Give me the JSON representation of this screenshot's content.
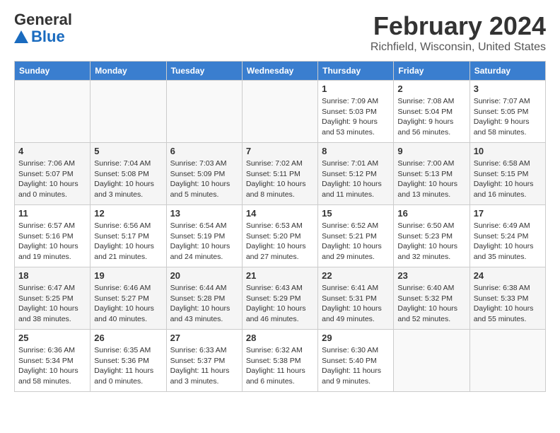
{
  "header": {
    "logo_general": "General",
    "logo_blue": "Blue",
    "title": "February 2024",
    "subtitle": "Richfield, Wisconsin, United States"
  },
  "columns": [
    "Sunday",
    "Monday",
    "Tuesday",
    "Wednesday",
    "Thursday",
    "Friday",
    "Saturday"
  ],
  "weeks": [
    [
      {
        "day": "",
        "info": ""
      },
      {
        "day": "",
        "info": ""
      },
      {
        "day": "",
        "info": ""
      },
      {
        "day": "",
        "info": ""
      },
      {
        "day": "1",
        "info": "Sunrise: 7:09 AM\nSunset: 5:03 PM\nDaylight: 9 hours\nand 53 minutes."
      },
      {
        "day": "2",
        "info": "Sunrise: 7:08 AM\nSunset: 5:04 PM\nDaylight: 9 hours\nand 56 minutes."
      },
      {
        "day": "3",
        "info": "Sunrise: 7:07 AM\nSunset: 5:05 PM\nDaylight: 9 hours\nand 58 minutes."
      }
    ],
    [
      {
        "day": "4",
        "info": "Sunrise: 7:06 AM\nSunset: 5:07 PM\nDaylight: 10 hours\nand 0 minutes."
      },
      {
        "day": "5",
        "info": "Sunrise: 7:04 AM\nSunset: 5:08 PM\nDaylight: 10 hours\nand 3 minutes."
      },
      {
        "day": "6",
        "info": "Sunrise: 7:03 AM\nSunset: 5:09 PM\nDaylight: 10 hours\nand 5 minutes."
      },
      {
        "day": "7",
        "info": "Sunrise: 7:02 AM\nSunset: 5:11 PM\nDaylight: 10 hours\nand 8 minutes."
      },
      {
        "day": "8",
        "info": "Sunrise: 7:01 AM\nSunset: 5:12 PM\nDaylight: 10 hours\nand 11 minutes."
      },
      {
        "day": "9",
        "info": "Sunrise: 7:00 AM\nSunset: 5:13 PM\nDaylight: 10 hours\nand 13 minutes."
      },
      {
        "day": "10",
        "info": "Sunrise: 6:58 AM\nSunset: 5:15 PM\nDaylight: 10 hours\nand 16 minutes."
      }
    ],
    [
      {
        "day": "11",
        "info": "Sunrise: 6:57 AM\nSunset: 5:16 PM\nDaylight: 10 hours\nand 19 minutes."
      },
      {
        "day": "12",
        "info": "Sunrise: 6:56 AM\nSunset: 5:17 PM\nDaylight: 10 hours\nand 21 minutes."
      },
      {
        "day": "13",
        "info": "Sunrise: 6:54 AM\nSunset: 5:19 PM\nDaylight: 10 hours\nand 24 minutes."
      },
      {
        "day": "14",
        "info": "Sunrise: 6:53 AM\nSunset: 5:20 PM\nDaylight: 10 hours\nand 27 minutes."
      },
      {
        "day": "15",
        "info": "Sunrise: 6:52 AM\nSunset: 5:21 PM\nDaylight: 10 hours\nand 29 minutes."
      },
      {
        "day": "16",
        "info": "Sunrise: 6:50 AM\nSunset: 5:23 PM\nDaylight: 10 hours\nand 32 minutes."
      },
      {
        "day": "17",
        "info": "Sunrise: 6:49 AM\nSunset: 5:24 PM\nDaylight: 10 hours\nand 35 minutes."
      }
    ],
    [
      {
        "day": "18",
        "info": "Sunrise: 6:47 AM\nSunset: 5:25 PM\nDaylight: 10 hours\nand 38 minutes."
      },
      {
        "day": "19",
        "info": "Sunrise: 6:46 AM\nSunset: 5:27 PM\nDaylight: 10 hours\nand 40 minutes."
      },
      {
        "day": "20",
        "info": "Sunrise: 6:44 AM\nSunset: 5:28 PM\nDaylight: 10 hours\nand 43 minutes."
      },
      {
        "day": "21",
        "info": "Sunrise: 6:43 AM\nSunset: 5:29 PM\nDaylight: 10 hours\nand 46 minutes."
      },
      {
        "day": "22",
        "info": "Sunrise: 6:41 AM\nSunset: 5:31 PM\nDaylight: 10 hours\nand 49 minutes."
      },
      {
        "day": "23",
        "info": "Sunrise: 6:40 AM\nSunset: 5:32 PM\nDaylight: 10 hours\nand 52 minutes."
      },
      {
        "day": "24",
        "info": "Sunrise: 6:38 AM\nSunset: 5:33 PM\nDaylight: 10 hours\nand 55 minutes."
      }
    ],
    [
      {
        "day": "25",
        "info": "Sunrise: 6:36 AM\nSunset: 5:34 PM\nDaylight: 10 hours\nand 58 minutes."
      },
      {
        "day": "26",
        "info": "Sunrise: 6:35 AM\nSunset: 5:36 PM\nDaylight: 11 hours\nand 0 minutes."
      },
      {
        "day": "27",
        "info": "Sunrise: 6:33 AM\nSunset: 5:37 PM\nDaylight: 11 hours\nand 3 minutes."
      },
      {
        "day": "28",
        "info": "Sunrise: 6:32 AM\nSunset: 5:38 PM\nDaylight: 11 hours\nand 6 minutes."
      },
      {
        "day": "29",
        "info": "Sunrise: 6:30 AM\nSunset: 5:40 PM\nDaylight: 11 hours\nand 9 minutes."
      },
      {
        "day": "",
        "info": ""
      },
      {
        "day": "",
        "info": ""
      }
    ]
  ]
}
